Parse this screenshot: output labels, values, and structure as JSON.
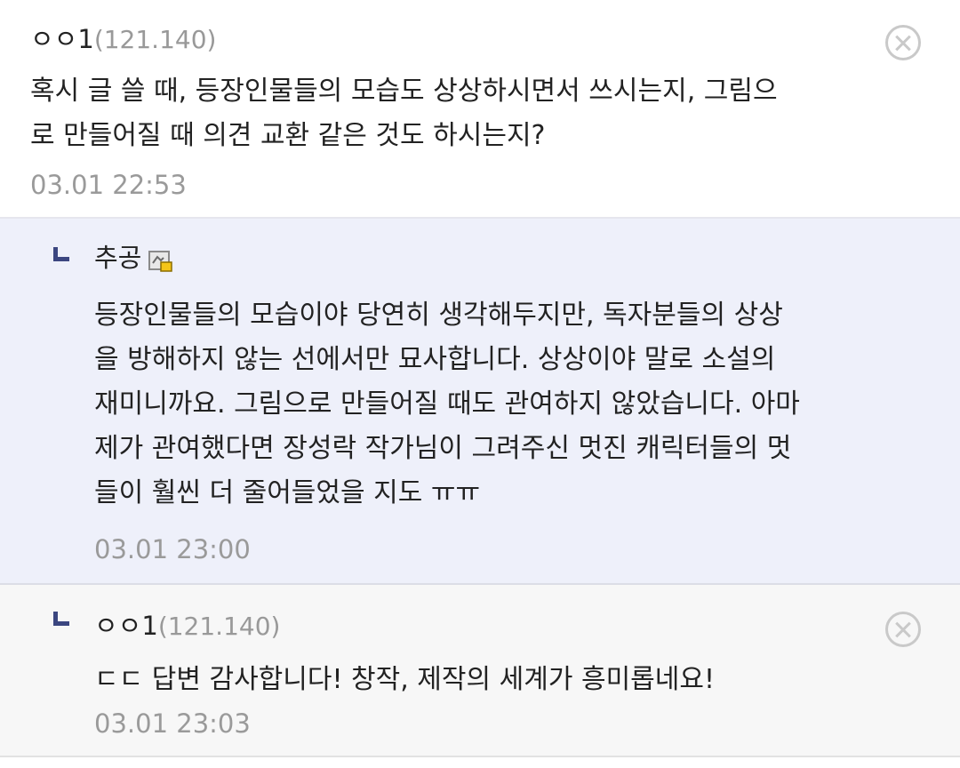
{
  "comments": [
    {
      "nick": "ㅇㅇ1",
      "ip": "(121.140)",
      "text": "혹시 글 쓸 때, 등장인물들의 모습도 상상하시면서 쓰시는지, 그림으\n로 만들어질 때 의견 교환 같은 것도 하시는지?",
      "date": "03.01 22:53",
      "close_icon": "close-circle-icon"
    },
    {
      "nick": "추공",
      "badge_icon": "author-badge-icon",
      "text": "등장인물들의 모습이야 당연히 생각해두지만, 독자분들의 상상\n을 방해하지 않는 선에서만 묘사합니다. 상상이야 말로 소설의\n재미니까요. 그림으로 만들어질 때도 관여하지 않았습니다. 아마\n제가 관여했다면 장성락 작가님이 그려주신 멋진 캐릭터들의 멋\n들이 훨씬 더 줄어들었을 지도 ㅠㅠ",
      "date": "03.01 23:00",
      "reply_icon": "reply-arrow-icon"
    },
    {
      "nick": "ㅇㅇ1",
      "ip": "(121.140)",
      "text": "ㄷㄷ 답변 감사합니다! 창작, 제작의 세계가 흥미롭네요!",
      "date": "03.01 23:03",
      "reply_icon": "reply-arrow-icon",
      "close_icon": "close-circle-icon"
    }
  ]
}
